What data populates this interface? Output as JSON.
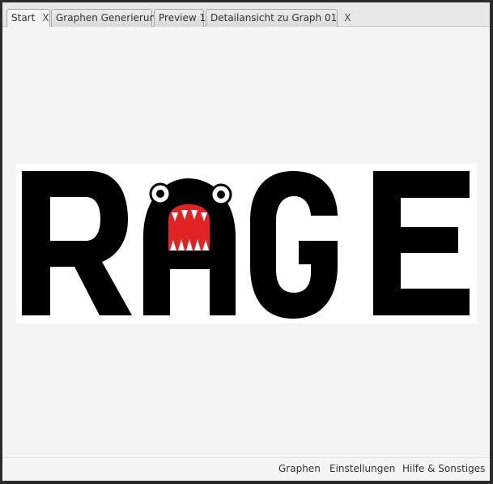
{
  "tabs": [
    {
      "label": "Start",
      "closable": true,
      "active": true
    },
    {
      "label": "Graphen Generierung",
      "closable": false,
      "active": false
    },
    {
      "label": "Preview 1",
      "closable": false,
      "active": false
    },
    {
      "label": "Detailansicht zu Graph 01",
      "closable": true,
      "active": false
    }
  ],
  "close_glyph": "X",
  "logo": {
    "letters": [
      "R",
      "A",
      "G",
      "E"
    ],
    "a_style": "monster-face",
    "colors": {
      "ink": "#000000",
      "mouth": "#e02424",
      "teeth": "#ffffff",
      "background": "#ffffff"
    }
  },
  "footer": {
    "links": [
      "Graphen",
      "Einstellungen",
      "Hilfe & Sonstiges"
    ]
  }
}
